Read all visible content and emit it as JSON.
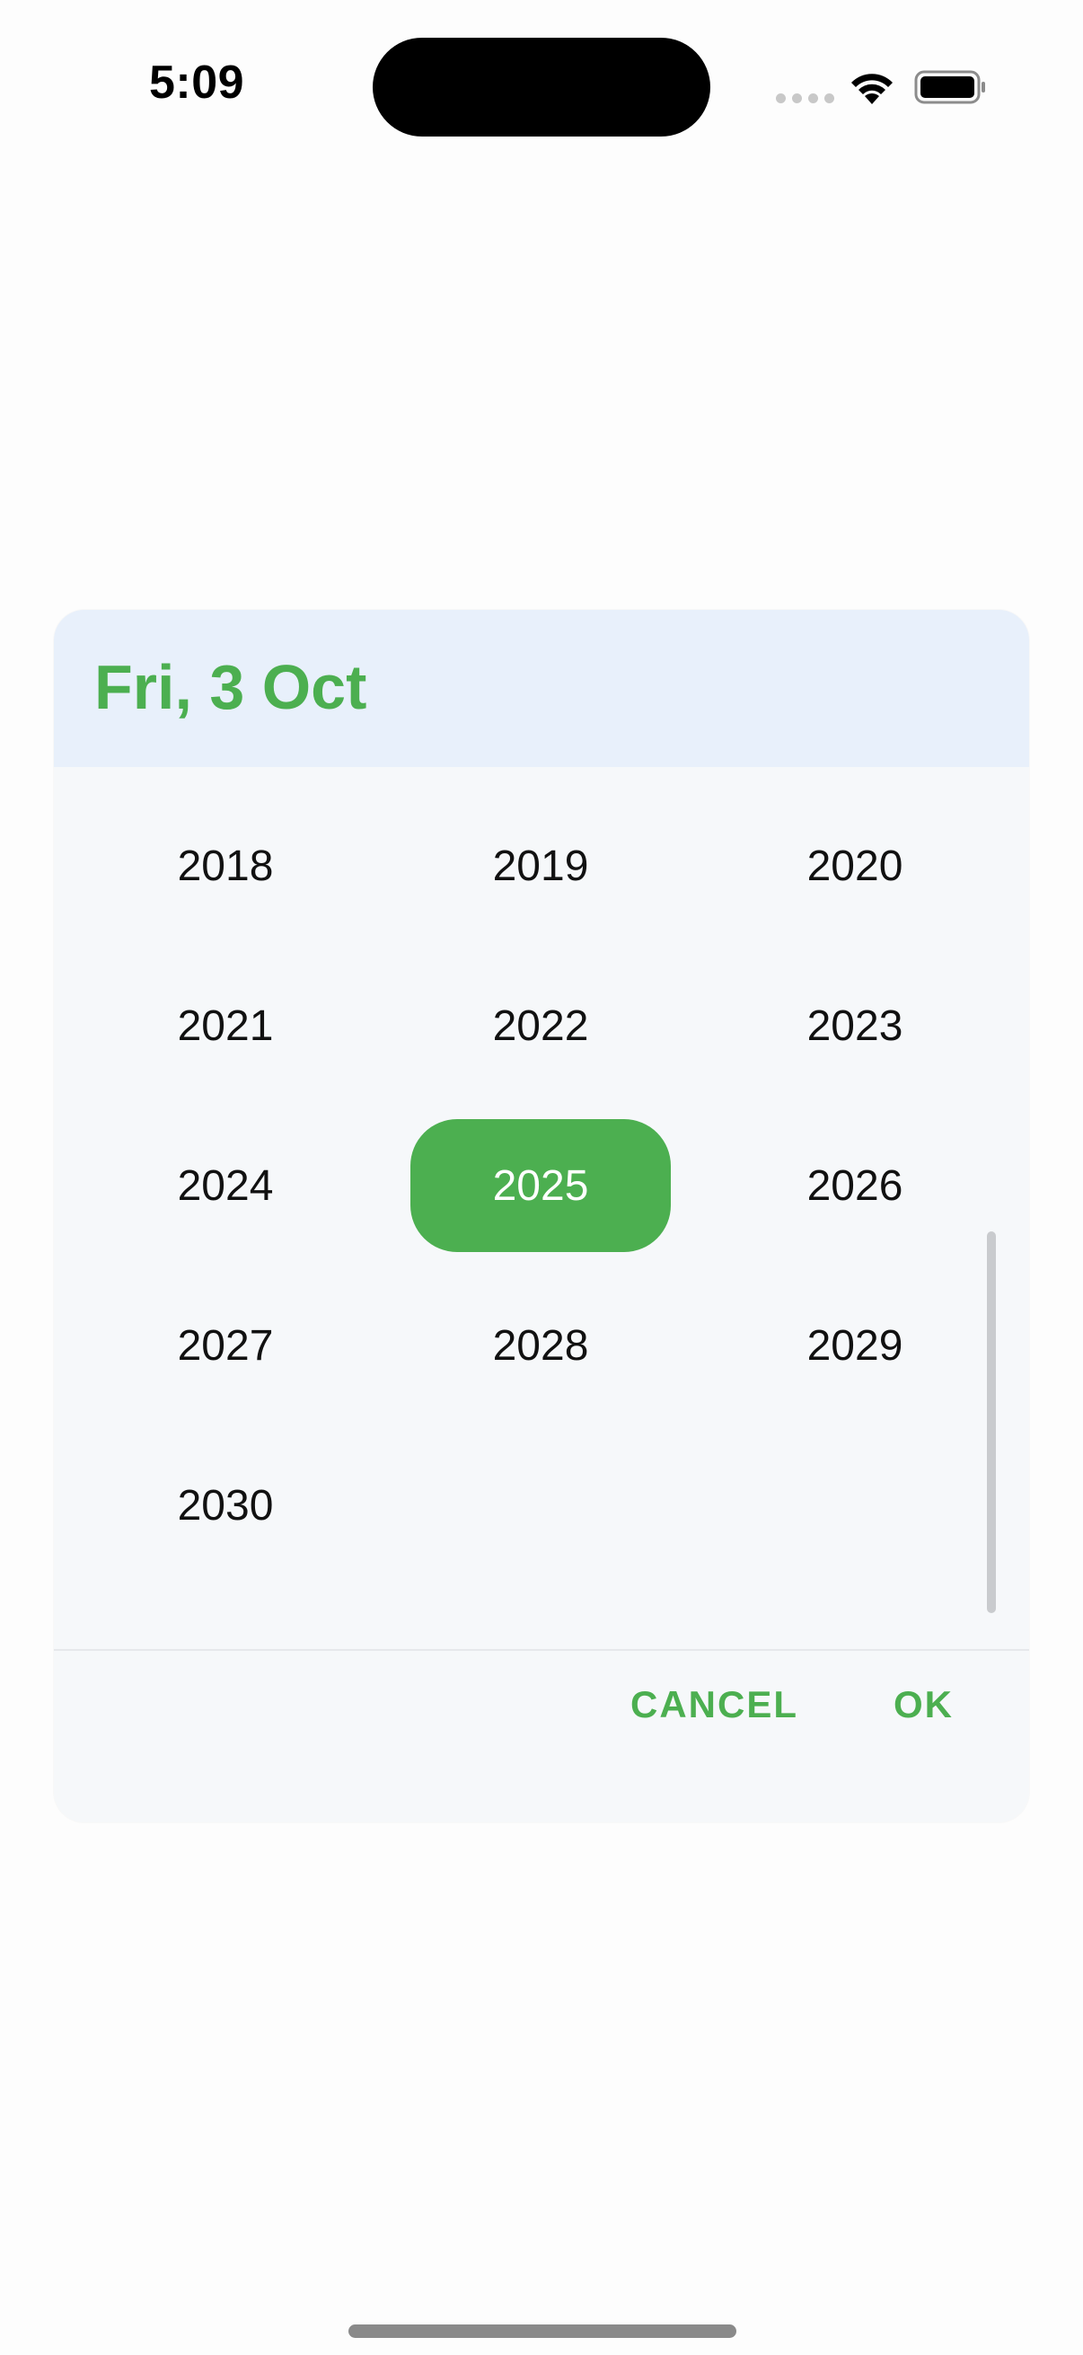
{
  "status_bar": {
    "time": "5:09"
  },
  "dialog": {
    "title": "Fri, 3 Oct",
    "years": [
      "2018",
      "2019",
      "2020",
      "2021",
      "2022",
      "2023",
      "2024",
      "2025",
      "2026",
      "2027",
      "2028",
      "2029",
      "2030"
    ],
    "selected_year": "2025",
    "cancel_label": "CANCEL",
    "ok_label": "OK"
  },
  "colors": {
    "accent": "#4CAF50",
    "header_bg": "#E8F0FB",
    "dialog_bg": "#F6F8FA"
  },
  "icons": [
    "wifi-icon",
    "battery-icon",
    "cellular-signal-icon"
  ]
}
